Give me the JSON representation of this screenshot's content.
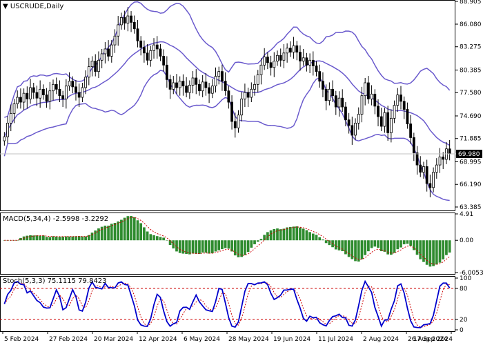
{
  "chart_data": [
    {
      "type": "candlestick",
      "title": "USCRUDE,Daily",
      "current_price": "69.980",
      "y_ticks": [
        "88.905",
        "86.080",
        "83.275",
        "80.385",
        "77.580",
        "74.690",
        "71.885",
        "68.995",
        "66.190",
        "63.385"
      ],
      "ylim": [
        63.385,
        88.905
      ],
      "x_ticks": [
        "5 Feb 2024",
        "27 Feb 2024",
        "20 Mar 2024",
        "12 Apr 2024",
        "6 May 2024",
        "28 May 2024",
        "19 Jun 2024",
        "11 Jul 2024",
        "2 Aug 2024",
        "26 Aug 2024",
        "17 Sep 2024"
      ],
      "closes": [
        72.1,
        73.8,
        75.0,
        76.2,
        77.0,
        76.4,
        77.5,
        76.8,
        78.2,
        77.6,
        76.9,
        78.0,
        77.3,
        76.5,
        77.8,
        78.6,
        78.0,
        77.2,
        76.8,
        78.4,
        79.0,
        78.3,
        77.6,
        77.0,
        78.2,
        79.5,
        80.8,
        81.5,
        80.2,
        81.6,
        82.4,
        83.0,
        82.1,
        83.5,
        84.6,
        86.0,
        86.9,
        86.2,
        87.1,
        86.3,
        85.5,
        84.0,
        83.2,
        82.5,
        81.6,
        82.8,
        83.5,
        83.0,
        82.1,
        81.0,
        79.2,
        78.0,
        78.8,
        78.2,
        79.0,
        78.4,
        77.6,
        78.5,
        79.4,
        78.6,
        77.8,
        78.9,
        78.2,
        77.5,
        78.4,
        79.6,
        80.2,
        79.0,
        77.8,
        76.4,
        74.0,
        73.2,
        74.8,
        76.8,
        77.6,
        77.0,
        78.0,
        78.6,
        79.8,
        81.0,
        82.0,
        81.3,
        80.7,
        81.5,
        82.2,
        81.6,
        82.5,
        83.1,
        82.6,
        83.4,
        82.6,
        81.5,
        81.9,
        81.0,
        81.6,
        80.9,
        80.2,
        79.0,
        78.0,
        76.6,
        78.0,
        77.2,
        75.8,
        76.9,
        75.8,
        74.2,
        73.5,
        72.3,
        73.8,
        74.9,
        77.2,
        78.8,
        76.8,
        77.4,
        75.9,
        74.6,
        73.4,
        75.1,
        72.6,
        74.4,
        76.0,
        77.3,
        76.5,
        75.5,
        73.7,
        72.0,
        70.1,
        68.6,
        67.7,
        68.4,
        66.3,
        65.8,
        67.7,
        68.6,
        69.6,
        69.3,
        70.6,
        69.98
      ],
      "bollinger": {
        "period": 20,
        "upper_band": "visible",
        "middle_band": "visible",
        "lower_band": "visible"
      },
      "colors": {
        "bull_candle": "#ffffff",
        "bear_candle": "#000000",
        "bands": "#6a5acd"
      }
    },
    {
      "type": "bar",
      "title": "MACD(5,34,4) -2.5998 -3.2292",
      "y_ticks": [
        "4.91",
        "0.00",
        "-6.0053"
      ],
      "ylim": [
        -6.0053,
        4.91
      ],
      "colors": {
        "histogram": "#2e8b2e",
        "signal": "#cc0000"
      }
    },
    {
      "type": "line",
      "title": "Stoch(5,3,3) 75.1115 79.8423",
      "y_ticks": [
        "100",
        "80",
        "20",
        "0"
      ],
      "ylim": [
        0,
        100
      ],
      "levels": [
        80,
        20
      ],
      "colors": {
        "main": "#0000cc",
        "signal": "#cc0000",
        "levels": "#cc0000"
      }
    }
  ]
}
